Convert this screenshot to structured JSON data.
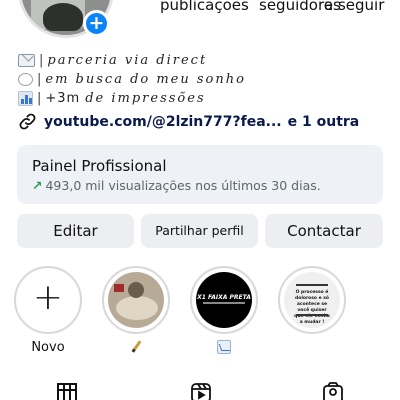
{
  "profile": {
    "stats": [
      {
        "label": "publicações"
      },
      {
        "label": "seguidores"
      },
      {
        "label": "a seguir"
      }
    ]
  },
  "bio": {
    "lines": [
      {
        "emoji": "envelope-icon",
        "separator": "|",
        "text": "parceria via direct"
      },
      {
        "emoji": "speech-bubble-icon",
        "separator": "|",
        "text": "em busca do meu sonho"
      },
      {
        "emoji": "chart-icon",
        "separator": "|",
        "prefix": "+3m",
        "text": "de impressões"
      }
    ],
    "link": {
      "text": "youtube.com/@2lzin777?fea...",
      "more": "e 1 outra"
    }
  },
  "dashboard": {
    "title": "Painel Profissional",
    "subtitle": "493,0 mil visualizações nos últimos 30 dias."
  },
  "actions": {
    "edit": "Editar",
    "share": "Partilhar perfil",
    "contact": "Contactar"
  },
  "highlights": [
    {
      "label": "Novo"
    },
    {
      "label": "",
      "emoji": "pencil-icon"
    },
    {
      "label": "",
      "emoji": "chart-icon",
      "cover_text": "X1 FAIXA PRETA"
    },
    {
      "label": "",
      "cover_text": "O processo é doloroso e só acontece se você quiser que ele venha a mudar !"
    }
  ],
  "colors": {
    "accent_blue": "#0a84f7",
    "button_bg": "#eceef1",
    "panel_bg": "#eef1f5",
    "trend_green": "#2a9d5c"
  },
  "tabs": [
    {
      "icon": "grid-icon"
    },
    {
      "icon": "reels-icon"
    },
    {
      "icon": "tagged-icon"
    }
  ]
}
